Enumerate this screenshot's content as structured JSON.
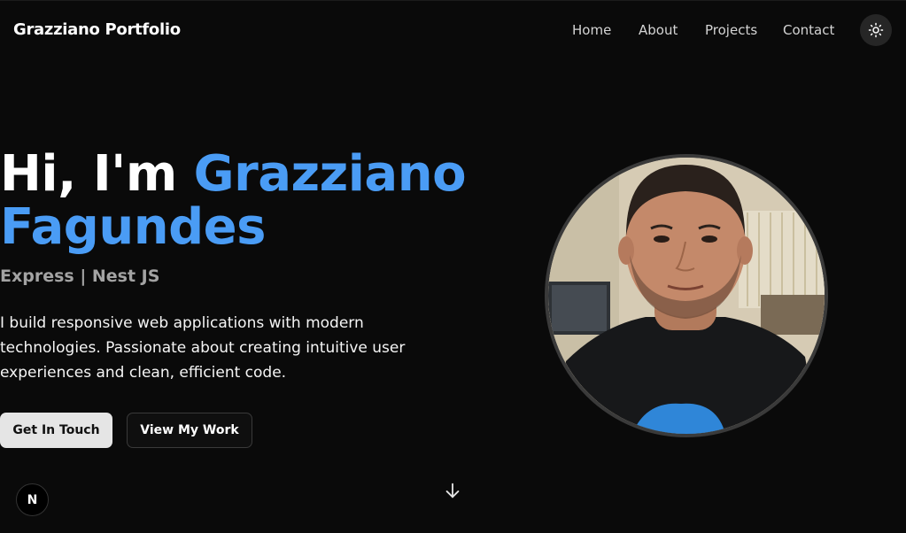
{
  "header": {
    "brand": "Grazziano Portfolio",
    "nav": [
      {
        "label": "Home"
      },
      {
        "label": "About"
      },
      {
        "label": "Projects"
      },
      {
        "label": "Contact"
      }
    ],
    "theme_toggle_icon": "sun-icon"
  },
  "hero": {
    "greeting": "Hi, I'm",
    "name_first": "Grazziano",
    "name_last": "Fagundes",
    "subtitle": "Express | Nest JS",
    "description": "I build responsive web applications with modern technologies. Passionate about creating intuitive user experiences and clean, efficient code.",
    "primary_button": "Get In Touch",
    "secondary_button": "View My Work",
    "avatar_icon": "profile-photo",
    "scroll_icon": "arrow-down-icon"
  },
  "badge": {
    "letter": "N"
  },
  "colors": {
    "background": "#0a0a0a",
    "accent": "#4a9cf5",
    "subtitle": "#a3a3a3"
  }
}
